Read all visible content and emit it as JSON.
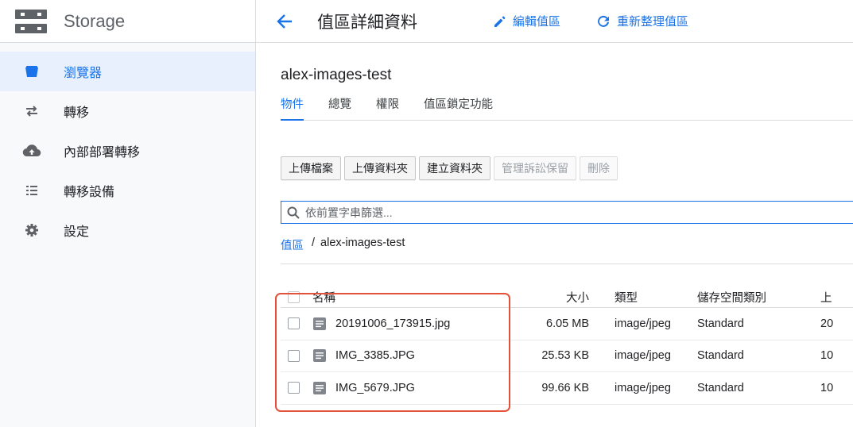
{
  "app": {
    "title": "Storage"
  },
  "sidebar": {
    "items": [
      {
        "label": "瀏覽器",
        "icon": "bucket-icon",
        "active": true
      },
      {
        "label": "轉移",
        "icon": "transfer-arrows-icon",
        "active": false
      },
      {
        "label": "內部部署轉移",
        "icon": "cloud-upload-icon",
        "active": false
      },
      {
        "label": "轉移設備",
        "icon": "appliance-list-icon",
        "active": false
      },
      {
        "label": "設定",
        "icon": "gear-icon",
        "active": false
      }
    ]
  },
  "header": {
    "title": "值區詳細資料",
    "edit_label": "編輯值區",
    "refresh_label": "重新整理值區"
  },
  "bucket": {
    "name": "alex-images-test"
  },
  "tabs": [
    {
      "label": "物件",
      "active": true
    },
    {
      "label": "總覽",
      "active": false
    },
    {
      "label": "權限",
      "active": false
    },
    {
      "label": "值區鎖定功能",
      "active": false
    }
  ],
  "toolbar": {
    "upload_files": "上傳檔案",
    "upload_folder": "上傳資料夾",
    "create_folder": "建立資料夾",
    "manage_holds": "管理訴訟保留",
    "delete": "刪除"
  },
  "filter": {
    "placeholder": "依前置字串篩選..."
  },
  "breadcrumb": {
    "root": "值區",
    "separator": "/",
    "current": "alex-images-test"
  },
  "table": {
    "headers": {
      "name": "名稱",
      "size": "大小",
      "type": "類型",
      "storage_class": "儲存空間類別",
      "extra": "上"
    },
    "rows": [
      {
        "name": "20191006_173915.jpg",
        "size": "6.05 MB",
        "type": "image/jpeg",
        "storage_class": "Standard",
        "extra": "20"
      },
      {
        "name": "IMG_3385.JPG",
        "size": "25.53 KB",
        "type": "image/jpeg",
        "storage_class": "Standard",
        "extra": "10"
      },
      {
        "name": "IMG_5679.JPG",
        "size": "99.66 KB",
        "type": "image/jpeg",
        "storage_class": "Standard",
        "extra": "10"
      }
    ]
  },
  "colors": {
    "accent": "#1a73e8",
    "highlight": "#e4513a",
    "sidebar_active_bg": "#e8f0fe"
  }
}
